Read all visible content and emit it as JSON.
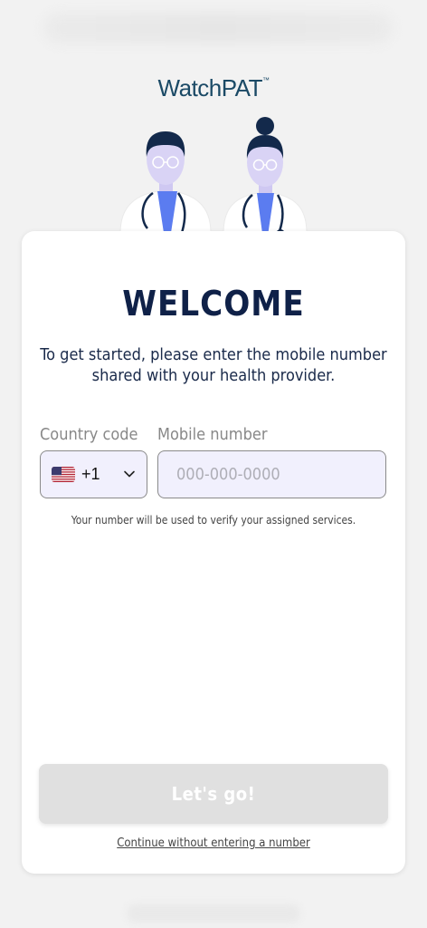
{
  "app": {
    "logo_text": "WatchPAT",
    "logo_tm": "™"
  },
  "welcome": {
    "title": "WELCOME",
    "subtitle_line1": "To get started, please enter the mobile number",
    "subtitle_line2": "shared with your health provider."
  },
  "form": {
    "country_code_label": "Country code",
    "mobile_number_label": "Mobile number",
    "country_code_value": "+1",
    "country_flag": "us-flag-icon",
    "mobile_placeholder": "000-000-0000",
    "mobile_value": "",
    "helper_text": "Your number will be used to verify your assigned services."
  },
  "actions": {
    "primary_label": "Let's go!",
    "primary_enabled": false,
    "skip_label": "Continue without entering a number"
  },
  "colors": {
    "title": "#0f2148",
    "logo": "#1b4a66",
    "input_bg": "#f1f0fd",
    "button_disabled": "#e0e0e0",
    "scrub_accent": "#5b7cf0"
  }
}
